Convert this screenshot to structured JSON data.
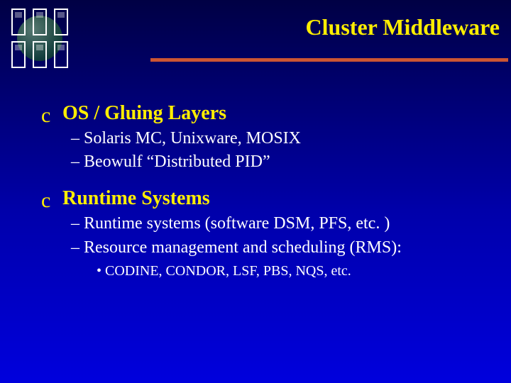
{
  "title": "Cluster Middleware",
  "bullet_glyph": "c",
  "sections": [
    {
      "heading": "OS /  Gluing Layers",
      "subs": [
        {
          "text": "– Solaris MC, Unixware, MOSIX"
        },
        {
          "text": "– Beowulf “Distributed PID”"
        }
      ]
    },
    {
      "heading": "Runtime Systems",
      "subs": [
        {
          "text": "– Runtime systems (software DSM, PFS, etc. )"
        },
        {
          "text": "– Resource management and scheduling (RMS):",
          "subsubs": [
            {
              "text": "• CODINE, CONDOR, LSF, PBS, NQS, etc."
            }
          ]
        }
      ]
    }
  ]
}
